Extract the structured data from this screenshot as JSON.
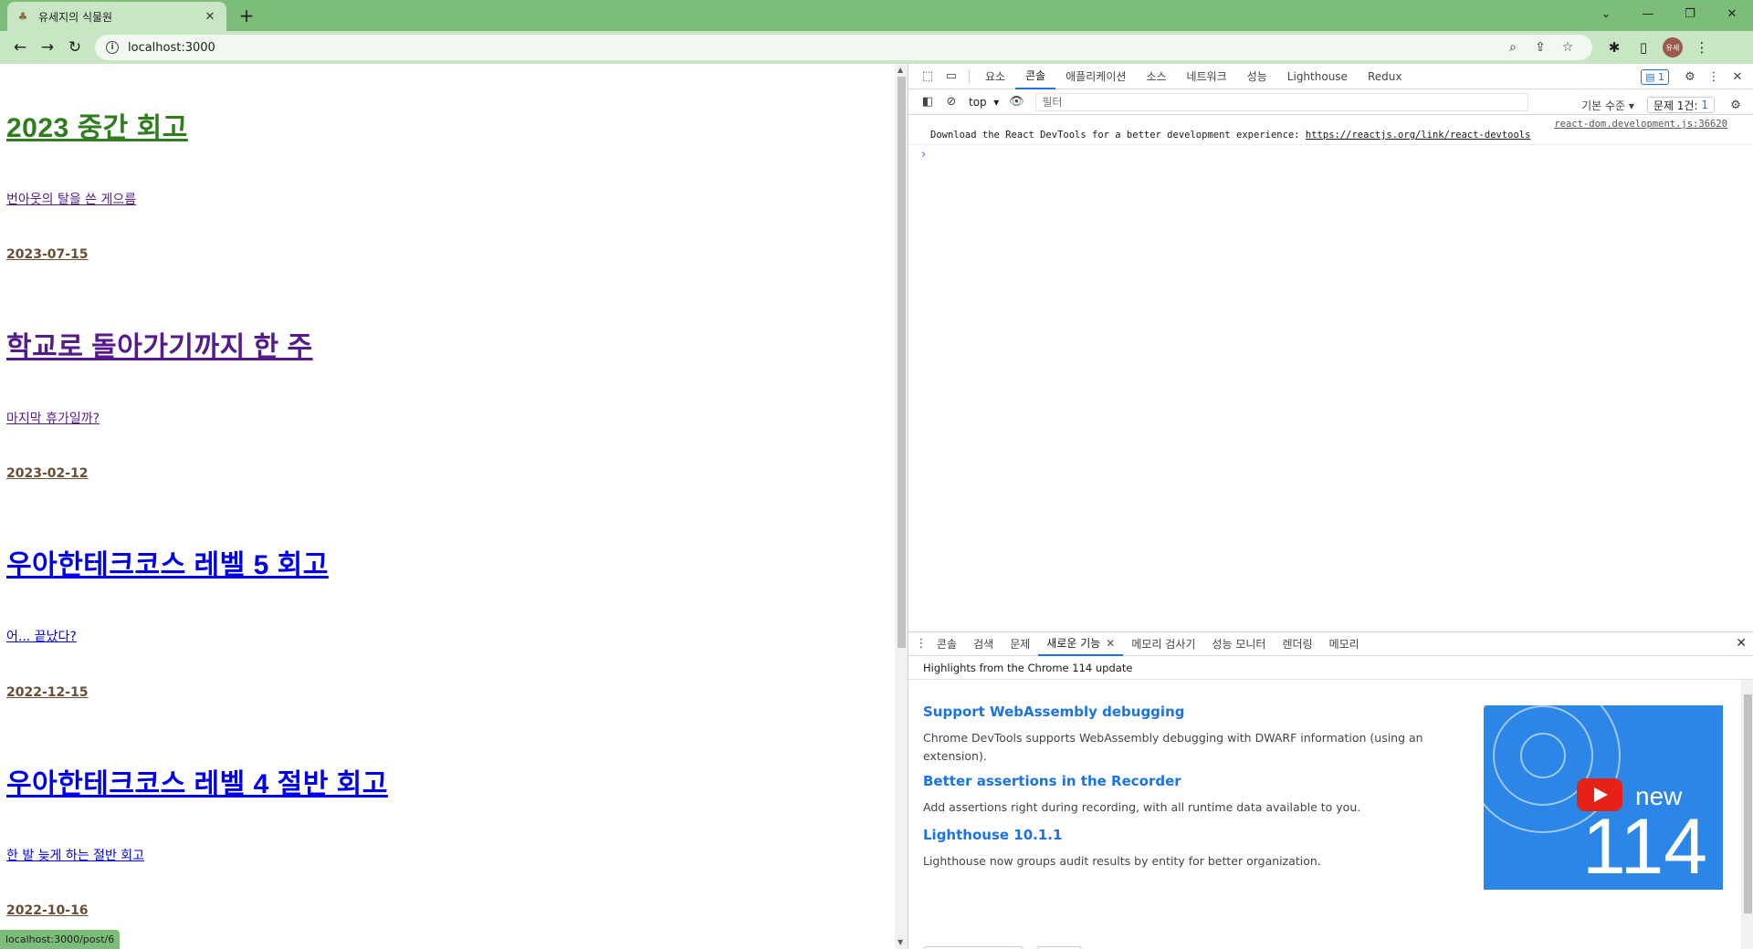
{
  "browser": {
    "tab_title": "유세지의 식물원",
    "url": "localhost:3000",
    "status_url": "localhost:3000/post/6"
  },
  "posts": [
    {
      "title": "2023 중간 회고",
      "subtitle": "번아웃의 탈을 쓴 게으름",
      "date": "2023-07-15",
      "link_state": "hover"
    },
    {
      "title": "학교로 돌아가기까지 한 주",
      "subtitle": "마지막 휴가일까?",
      "date": "2023-02-12",
      "link_state": "visited"
    },
    {
      "title": "우아한테크코스 레벨 5 회고",
      "subtitle": "어... 끝났다?",
      "date": "2022-12-15",
      "link_state": "unvisited"
    },
    {
      "title": "우아한테크코스 레벨 4 절반 회고",
      "subtitle": "한 발 늦게 하는 절반 회고",
      "date": "2022-10-16",
      "link_state": "unvisited"
    }
  ],
  "devtools": {
    "tabs": [
      "요소",
      "콘솔",
      "애플리케이션",
      "소스",
      "네트워크",
      "성능",
      "Lighthouse",
      "Redux"
    ],
    "active_tab": "콘솔",
    "issue_badge": "1",
    "context": "top",
    "filter_placeholder": "필터",
    "log_level": "기본 수준",
    "issues_label": "문제 1건:",
    "issues_count": "1",
    "console": {
      "source": "react-dom.development.js:36620",
      "message": "Download the React DevTools for a better development experience: ",
      "link": "https://reactjs.org/link/react-devtools"
    },
    "drawer_tabs": [
      "콘솔",
      "검색",
      "문제",
      "새로운 기능",
      "메모리 검사기",
      "성능 모니터",
      "렌더링",
      "메모리"
    ],
    "drawer_active": "새로운 기능",
    "whats_new": {
      "highlights": "Highlights from the Chrome 114 update",
      "items": [
        {
          "heading": "Support WebAssembly debugging",
          "text": "Chrome DevTools supports WebAssembly debugging with DWARF information (using an extension)."
        },
        {
          "heading": "Better assertions in the Recorder",
          "text": "Add assertions right during recording, with all runtime data available to you."
        },
        {
          "heading": "Lighthouse 10.1.1",
          "text": "Lighthouse now groups audit results by entity for better organization."
        }
      ],
      "video_new": "new",
      "video_version": "114"
    }
  },
  "colors": {
    "frame": "#7cbd7a",
    "toolbar": "#c8e6c4",
    "link_hover": "#2f7d1e",
    "link_visited": "#551a8b",
    "link_unvisited": "#0000ee",
    "accent": "#1a73e8"
  }
}
